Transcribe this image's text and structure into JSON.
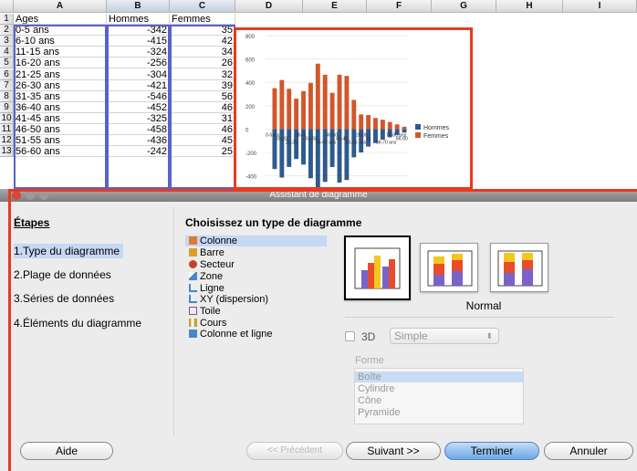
{
  "sheet": {
    "columns": [
      "A",
      "B",
      "C",
      "D",
      "E",
      "F",
      "G",
      "H",
      "I"
    ],
    "rows": [
      {
        "n": "1",
        "a": "Ages",
        "b": "Hommes",
        "c": "Femmes"
      },
      {
        "n": "2",
        "a": "0-5 ans",
        "b": "-342",
        "c": "35"
      },
      {
        "n": "3",
        "a": "6-10 ans",
        "b": "-415",
        "c": "42"
      },
      {
        "n": "4",
        "a": "11-15 ans",
        "b": "-324",
        "c": "34"
      },
      {
        "n": "5",
        "a": "16-20 ans",
        "b": "-256",
        "c": "26"
      },
      {
        "n": "6",
        "a": "21-25 ans",
        "b": "-304",
        "c": "32"
      },
      {
        "n": "7",
        "a": "26-30 ans",
        "b": "-421",
        "c": "39"
      },
      {
        "n": "8",
        "a": "31-35 ans",
        "b": "-546",
        "c": "56"
      },
      {
        "n": "9",
        "a": "36-40 ans",
        "b": "-452",
        "c": "46"
      },
      {
        "n": "10",
        "a": "41-45 ans",
        "b": "-325",
        "c": "31"
      },
      {
        "n": "11",
        "a": "46-50 ans",
        "b": "-458",
        "c": "46"
      },
      {
        "n": "12",
        "a": "51-55 ans",
        "b": "-436",
        "c": "45"
      },
      {
        "n": "13",
        "a": "56-60 ans",
        "b": "-242",
        "c": "25"
      }
    ]
  },
  "chart_data": {
    "type": "bar",
    "yticks": [
      "800",
      "600",
      "400",
      "200",
      "0",
      "-200",
      "-400"
    ],
    "ylim": [
      -450,
      800
    ],
    "category_label_fragments": [
      "0-5ans",
      "16-20",
      "21-25",
      "36-4",
      "51-55",
      "56-60 ans",
      "46-50",
      "41-45",
      "61-65 ans",
      "26-30",
      "41",
      "66-70 ans",
      "76-80 ans",
      "86-90"
    ],
    "series": [
      {
        "name": "Hommes",
        "color": "#2e5a8c",
        "values": [
          -342,
          -415,
          -324,
          -256,
          -304,
          -421,
          -546,
          -452,
          -325,
          -458,
          -436,
          -242,
          -200,
          -150,
          -120,
          -90,
          -70,
          -50,
          -30
        ]
      },
      {
        "name": "Femmes",
        "color": "#d3562b",
        "values": [
          350,
          420,
          345,
          260,
          325,
          395,
          560,
          465,
          310,
          465,
          455,
          250,
          125,
          120,
          95,
          80,
          60,
          40,
          20
        ]
      }
    ]
  },
  "dialog": {
    "title": "Assistant de diagramme",
    "steps_title": "Étapes",
    "steps": [
      "1.Type du diagramme",
      "2.Plage de données",
      "3.Séries de données",
      "4.Éléments du diagramme"
    ],
    "type_title": "Choisissez un type de diagramme",
    "types": [
      {
        "label": "Colonne",
        "icon": "column-chart-icon",
        "color": "#e07a2e"
      },
      {
        "label": "Barre",
        "icon": "bar-chart-icon",
        "color": "#d9a02a"
      },
      {
        "label": "Secteur",
        "icon": "pie-chart-icon",
        "color": "#c8402a"
      },
      {
        "label": "Zone",
        "icon": "area-chart-icon",
        "color": "#4a86c8"
      },
      {
        "label": "Ligne",
        "icon": "line-chart-icon",
        "color": "#4a86c8"
      },
      {
        "label": "XY (dispersion)",
        "icon": "scatter-chart-icon",
        "color": "#4a86c8"
      },
      {
        "label": "Toile",
        "icon": "net-chart-icon",
        "color": "#8a4a9e"
      },
      {
        "label": "Cours",
        "icon": "stock-chart-icon",
        "color": "#c8a040"
      },
      {
        "label": "Colonne et ligne",
        "icon": "column-line-chart-icon",
        "color": "#4a86c8"
      }
    ],
    "variant_label": "Normal",
    "three_d_label": "3D",
    "shape_select": "Simple",
    "shape_title": "Forme",
    "shapes": [
      "Boîte",
      "Cylindre",
      "Cône",
      "Pyramide"
    ],
    "buttons": {
      "help": "Aide",
      "previous": "<< Précédent",
      "next": "Suivant >>",
      "finish": "Terminer",
      "cancel": "Annuler"
    }
  }
}
